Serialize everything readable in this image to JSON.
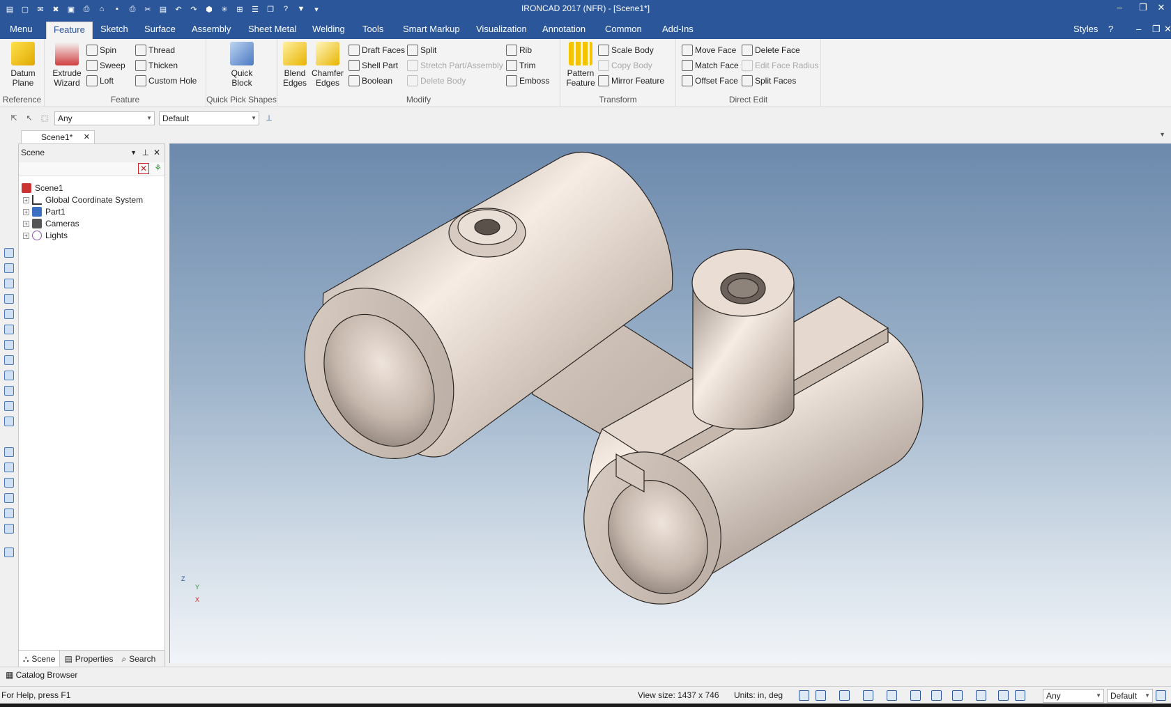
{
  "window": {
    "title": "IRONCAD 2017 (NFR) - [Scene1*]"
  },
  "menu_tabs": [
    "Menu",
    "Feature",
    "Sketch",
    "Surface",
    "Assembly",
    "Sheet Metal",
    "Welding",
    "Tools",
    "Smart Markup",
    "Visualization",
    "Annotation",
    "Common",
    "Add-Ins"
  ],
  "styles_label": "Styles",
  "ribbon": {
    "reference": {
      "label": "Reference",
      "datum_plane": "Datum\nPlane"
    },
    "feature": {
      "label": "Feature",
      "extrude_wizard": "Extrude\nWizard",
      "spin": "Spin",
      "sweep": "Sweep",
      "loft": "Loft",
      "thread": "Thread",
      "thicken": "Thicken",
      "custom_hole": "Custom Hole"
    },
    "quick_pick": {
      "label": "Quick Pick Shapes",
      "quick_block": "Quick\nBlock"
    },
    "modify": {
      "label": "Modify",
      "blend_edges": "Blend\nEdges",
      "chamfer_edges": "Chamfer\nEdges",
      "draft_faces": "Draft Faces",
      "shell_part": "Shell Part",
      "boolean": "Boolean",
      "split": "Split",
      "stretch": "Stretch Part/Assembly",
      "delete_body": "Delete Body",
      "rib": "Rib",
      "trim": "Trim",
      "emboss": "Emboss"
    },
    "transform": {
      "label": "Transform",
      "pattern_feature": "Pattern\nFeature",
      "scale_body": "Scale Body",
      "copy_body": "Copy Body",
      "mirror_feature": "Mirror Feature"
    },
    "direct_edit": {
      "label": "Direct Edit",
      "move_face": "Move Face",
      "match_face": "Match Face",
      "offset_face": "Offset Face",
      "delete_face": "Delete Face",
      "edit_face_radius": "Edit Face Radius",
      "split_faces": "Split Faces"
    }
  },
  "selection": {
    "filter": "Any",
    "style": "Default"
  },
  "doc_tab": "Scene1*",
  "scene_panel": {
    "title": "Scene",
    "tree": [
      {
        "label": "Scene1"
      },
      {
        "label": "Global Coordinate System"
      },
      {
        "label": "Part1"
      },
      {
        "label": "Cameras"
      },
      {
        "label": "Lights"
      }
    ],
    "bottom_tabs": [
      "Scene",
      "Properties",
      "Search"
    ]
  },
  "catalog_browser": "Catalog Browser",
  "status": {
    "help": "For Help, press F1",
    "view_size": "View size: 1437 x  746",
    "units": "Units: in, deg",
    "filter": "Any",
    "style": "Default"
  },
  "axis": {
    "z": "Z",
    "y": "Y",
    "x": "X"
  },
  "colors": {
    "accent": "#2b579a",
    "part": "#cbbdb1"
  }
}
